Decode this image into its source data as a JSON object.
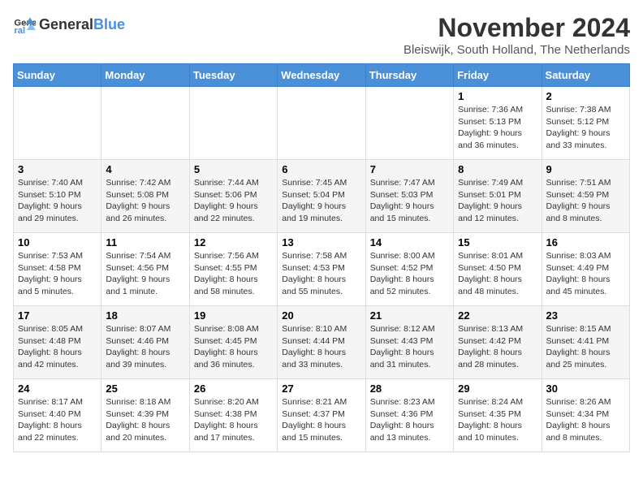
{
  "header": {
    "logo_general": "General",
    "logo_blue": "Blue",
    "month_title": "November 2024",
    "subtitle": "Bleiswijk, South Holland, The Netherlands"
  },
  "weekdays": [
    "Sunday",
    "Monday",
    "Tuesday",
    "Wednesday",
    "Thursday",
    "Friday",
    "Saturday"
  ],
  "weeks": [
    [
      {
        "day": "",
        "detail": ""
      },
      {
        "day": "",
        "detail": ""
      },
      {
        "day": "",
        "detail": ""
      },
      {
        "day": "",
        "detail": ""
      },
      {
        "day": "",
        "detail": ""
      },
      {
        "day": "1",
        "detail": "Sunrise: 7:36 AM\nSunset: 5:13 PM\nDaylight: 9 hours and 36 minutes."
      },
      {
        "day": "2",
        "detail": "Sunrise: 7:38 AM\nSunset: 5:12 PM\nDaylight: 9 hours and 33 minutes."
      }
    ],
    [
      {
        "day": "3",
        "detail": "Sunrise: 7:40 AM\nSunset: 5:10 PM\nDaylight: 9 hours and 29 minutes."
      },
      {
        "day": "4",
        "detail": "Sunrise: 7:42 AM\nSunset: 5:08 PM\nDaylight: 9 hours and 26 minutes."
      },
      {
        "day": "5",
        "detail": "Sunrise: 7:44 AM\nSunset: 5:06 PM\nDaylight: 9 hours and 22 minutes."
      },
      {
        "day": "6",
        "detail": "Sunrise: 7:45 AM\nSunset: 5:04 PM\nDaylight: 9 hours and 19 minutes."
      },
      {
        "day": "7",
        "detail": "Sunrise: 7:47 AM\nSunset: 5:03 PM\nDaylight: 9 hours and 15 minutes."
      },
      {
        "day": "8",
        "detail": "Sunrise: 7:49 AM\nSunset: 5:01 PM\nDaylight: 9 hours and 12 minutes."
      },
      {
        "day": "9",
        "detail": "Sunrise: 7:51 AM\nSunset: 4:59 PM\nDaylight: 9 hours and 8 minutes."
      }
    ],
    [
      {
        "day": "10",
        "detail": "Sunrise: 7:53 AM\nSunset: 4:58 PM\nDaylight: 9 hours and 5 minutes."
      },
      {
        "day": "11",
        "detail": "Sunrise: 7:54 AM\nSunset: 4:56 PM\nDaylight: 9 hours and 1 minute."
      },
      {
        "day": "12",
        "detail": "Sunrise: 7:56 AM\nSunset: 4:55 PM\nDaylight: 8 hours and 58 minutes."
      },
      {
        "day": "13",
        "detail": "Sunrise: 7:58 AM\nSunset: 4:53 PM\nDaylight: 8 hours and 55 minutes."
      },
      {
        "day": "14",
        "detail": "Sunrise: 8:00 AM\nSunset: 4:52 PM\nDaylight: 8 hours and 52 minutes."
      },
      {
        "day": "15",
        "detail": "Sunrise: 8:01 AM\nSunset: 4:50 PM\nDaylight: 8 hours and 48 minutes."
      },
      {
        "day": "16",
        "detail": "Sunrise: 8:03 AM\nSunset: 4:49 PM\nDaylight: 8 hours and 45 minutes."
      }
    ],
    [
      {
        "day": "17",
        "detail": "Sunrise: 8:05 AM\nSunset: 4:48 PM\nDaylight: 8 hours and 42 minutes."
      },
      {
        "day": "18",
        "detail": "Sunrise: 8:07 AM\nSunset: 4:46 PM\nDaylight: 8 hours and 39 minutes."
      },
      {
        "day": "19",
        "detail": "Sunrise: 8:08 AM\nSunset: 4:45 PM\nDaylight: 8 hours and 36 minutes."
      },
      {
        "day": "20",
        "detail": "Sunrise: 8:10 AM\nSunset: 4:44 PM\nDaylight: 8 hours and 33 minutes."
      },
      {
        "day": "21",
        "detail": "Sunrise: 8:12 AM\nSunset: 4:43 PM\nDaylight: 8 hours and 31 minutes."
      },
      {
        "day": "22",
        "detail": "Sunrise: 8:13 AM\nSunset: 4:42 PM\nDaylight: 8 hours and 28 minutes."
      },
      {
        "day": "23",
        "detail": "Sunrise: 8:15 AM\nSunset: 4:41 PM\nDaylight: 8 hours and 25 minutes."
      }
    ],
    [
      {
        "day": "24",
        "detail": "Sunrise: 8:17 AM\nSunset: 4:40 PM\nDaylight: 8 hours and 22 minutes."
      },
      {
        "day": "25",
        "detail": "Sunrise: 8:18 AM\nSunset: 4:39 PM\nDaylight: 8 hours and 20 minutes."
      },
      {
        "day": "26",
        "detail": "Sunrise: 8:20 AM\nSunset: 4:38 PM\nDaylight: 8 hours and 17 minutes."
      },
      {
        "day": "27",
        "detail": "Sunrise: 8:21 AM\nSunset: 4:37 PM\nDaylight: 8 hours and 15 minutes."
      },
      {
        "day": "28",
        "detail": "Sunrise: 8:23 AM\nSunset: 4:36 PM\nDaylight: 8 hours and 13 minutes."
      },
      {
        "day": "29",
        "detail": "Sunrise: 8:24 AM\nSunset: 4:35 PM\nDaylight: 8 hours and 10 minutes."
      },
      {
        "day": "30",
        "detail": "Sunrise: 8:26 AM\nSunset: 4:34 PM\nDaylight: 8 hours and 8 minutes."
      }
    ]
  ]
}
